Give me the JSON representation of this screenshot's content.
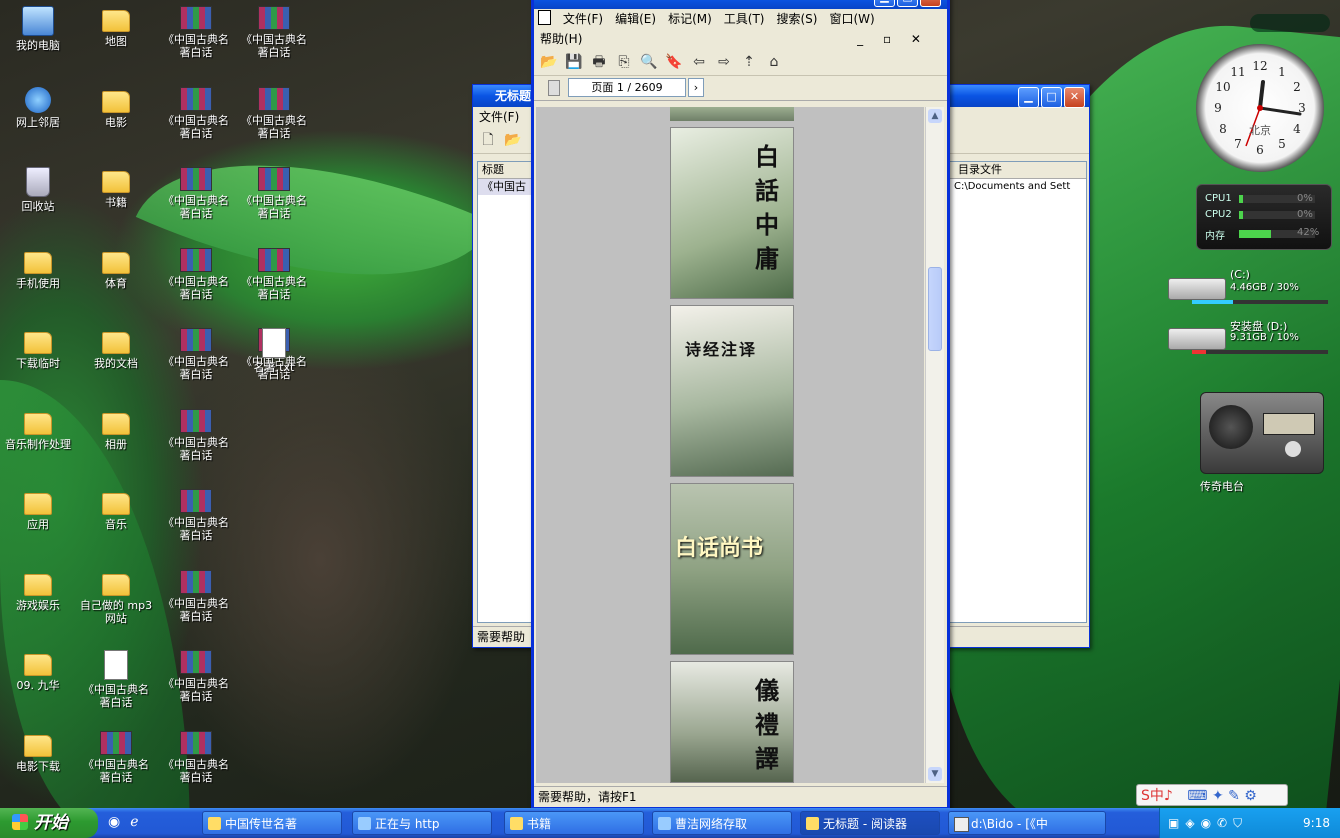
{
  "desktop_icons": [
    {
      "label": "我的电脑",
      "type": "pc"
    },
    {
      "label": "网上邻居",
      "type": "net"
    },
    {
      "label": "回收站",
      "type": "bin"
    },
    {
      "label": "手机使用",
      "type": "folder"
    },
    {
      "label": "下载临时",
      "type": "folder"
    },
    {
      "label": "音乐制作处理",
      "type": "folder"
    },
    {
      "label": "应用",
      "type": "folder"
    },
    {
      "label": "游戏娱乐",
      "type": "folder"
    },
    {
      "label": "09. 九华",
      "type": "folder"
    },
    {
      "label": "电影下载",
      "type": "folder"
    },
    {
      "label": "地图",
      "type": "folder"
    },
    {
      "label": "电影",
      "type": "folder"
    },
    {
      "label": "书籍",
      "type": "folder"
    },
    {
      "label": "体育",
      "type": "folder"
    },
    {
      "label": "我的文档",
      "type": "folder"
    },
    {
      "label": "相册",
      "type": "folder"
    },
    {
      "label": "音乐",
      "type": "folder"
    },
    {
      "label": "自己做的 mp3 网站",
      "type": "folder"
    },
    {
      "label": "《中国古典名著白话",
      "type": "doc"
    },
    {
      "label": "《中国古典名著白话",
      "type": "rar"
    },
    {
      "label": "《中国古典名著白话",
      "type": "rar"
    },
    {
      "label": "《中国古典名著白话",
      "type": "rar"
    },
    {
      "label": "《中国古典名著白话",
      "type": "rar"
    },
    {
      "label": "《中国古典名著白话",
      "type": "rar"
    },
    {
      "label": "《中国古典名著白话",
      "type": "rar"
    },
    {
      "label": "《中国古典名著白话",
      "type": "rar"
    },
    {
      "label": "《中国古典名著白话",
      "type": "rar"
    },
    {
      "label": "《中国古典名著白话",
      "type": "rar"
    },
    {
      "label": "《中国古典名著白话",
      "type": "rar"
    },
    {
      "label": "《中国古典名著白话",
      "type": "rar"
    },
    {
      "label": "《中国古典名著白话",
      "type": "rar"
    },
    {
      "label": "《中国古典名著白话",
      "type": "rar"
    },
    {
      "label": "《中国古典名著白话",
      "type": "rar"
    },
    {
      "label": "《中国古典名著白话",
      "type": "rar"
    },
    {
      "label": "《中国古典名著白话",
      "type": "rar"
    },
    {
      "label": "名著.txt",
      "type": "file"
    }
  ],
  "back_window": {
    "title": "无标题",
    "menu_label": "文件(F)",
    "col_title": "标题",
    "col_file": "目录文件",
    "row_title": "《中国古",
    "row_file": "C:\\Documents and Sett",
    "status": "需要帮助"
  },
  "reader_window": {
    "menus": [
      "文件(F)",
      "编辑(E)",
      "标记(M)",
      "工具(T)",
      "搜索(S)",
      "窗口(W)"
    ],
    "help_menu": "帮助(H)",
    "page_label": "页面 1 / 2609",
    "books": [
      "白話中庸",
      "诗经注译",
      "白话尚书",
      "儀禮譯"
    ],
    "status": "需要帮助，请按F1"
  },
  "gadgets": {
    "clock_city": "北京",
    "cpu1_label": "CPU1",
    "cpu1_value": "0%",
    "cpu1_fraction": 0.05,
    "cpu2_label": "CPU2",
    "cpu2_value": "0%",
    "cpu2_fraction": 0.05,
    "mem_label": "内存",
    "mem_value": "42%",
    "mem_fraction": 0.42,
    "drive_c_name": "(C:)",
    "drive_c_info": "4.46GB / 30%",
    "drive_c_fraction": 0.3,
    "drive_d_name": "安装盘 (D:)",
    "drive_d_info": "9.31GB / 10%",
    "drive_d_fraction": 0.1,
    "radio_label": "传奇电台"
  },
  "taskbar": {
    "start_label": "开始",
    "buttons": [
      "中国传世名著",
      "正在与 http",
      "书籍",
      "曹洁网络存取",
      "无标题 - 阅读器"
    ],
    "tray_item": "d:\\Bido - [《中",
    "time": "9:18"
  },
  "ime": {
    "text": "S中♪"
  }
}
